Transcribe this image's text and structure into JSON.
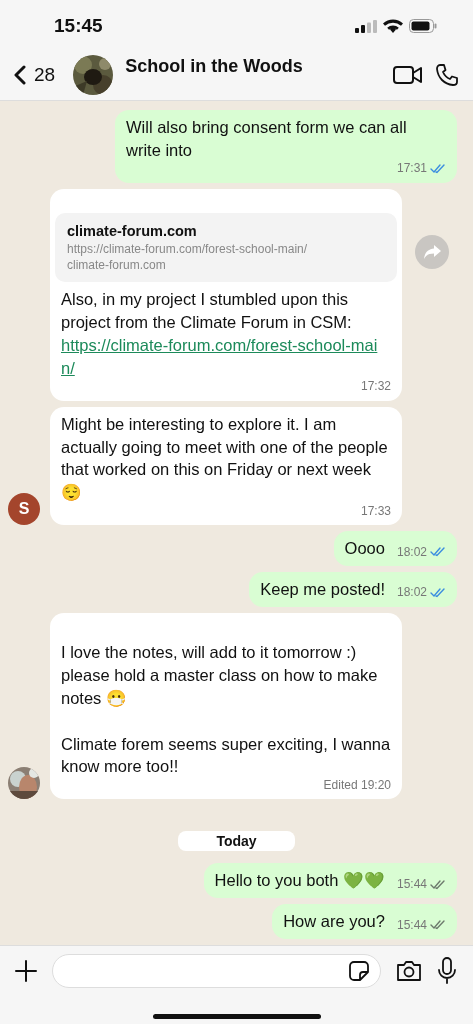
{
  "status_bar": {
    "time": "15:45"
  },
  "header": {
    "back_count": "28",
    "title": "School in the Woods"
  },
  "messages": [
    {
      "kind": "out",
      "text": "Will also bring consent form we can all write into",
      "time": "17:31",
      "read": true
    },
    {
      "kind": "in",
      "preview": {
        "title": "climate-forum.com",
        "url": "https://climate-forum.com/forest-school-main/",
        "domain": "climate-forum.com"
      },
      "text": "Also, in my project I stumbled upon this project from the Climate Forum in CSM:",
      "link": "https://climate-forum.com/forest-school-main/",
      "time": "17:32"
    },
    {
      "kind": "in",
      "avatar": {
        "kind": "letter",
        "letter": "S",
        "color": "#a4452c"
      },
      "text": "Might be interesting to explore it. I am actually going to meet with one of the people that worked on this on Friday or next week 😌",
      "time": "17:33"
    },
    {
      "kind": "out",
      "text": "Oooo",
      "time": "18:02",
      "read": true
    },
    {
      "kind": "out",
      "text": "Keep me posted!",
      "time": "18:02",
      "read": true
    },
    {
      "kind": "in",
      "text": "\nI love the notes, will add to it tomorrow :) please hold a master class on how to make notes 😷\n\nClimate forem seems super exciting, I wanna know more too!!",
      "time": "Edited 19:20"
    },
    {
      "kind": "date",
      "text": "Today"
    },
    {
      "kind": "out",
      "text": "Hello to you both 💚💚",
      "time": "15:44",
      "read": false
    },
    {
      "kind": "out",
      "text": "How are you?",
      "time": "15:44",
      "read": false
    }
  ]
}
